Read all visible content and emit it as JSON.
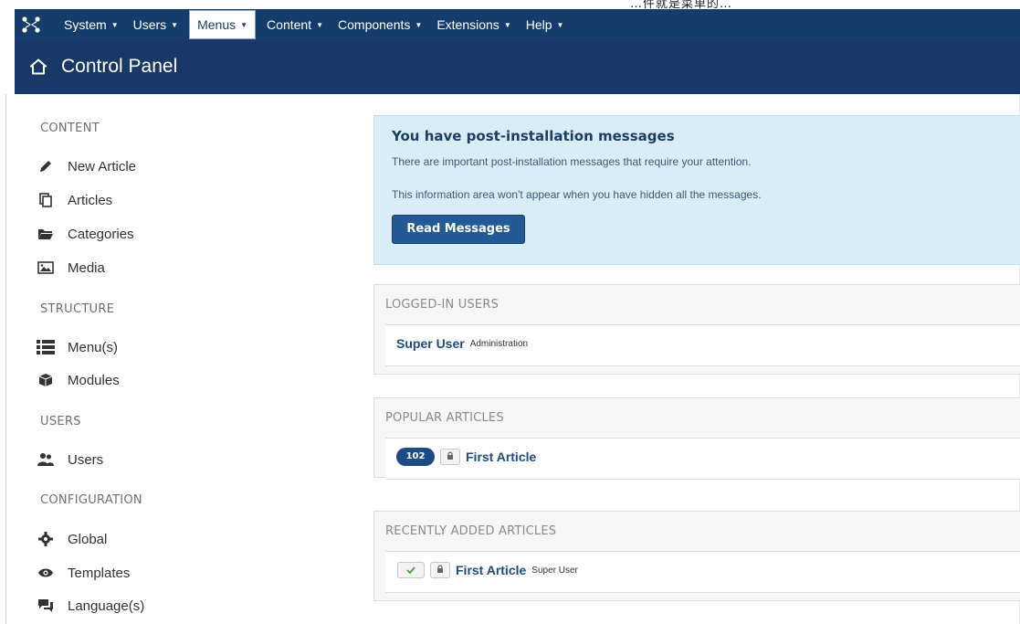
{
  "top_fragment": "…件就是菜单的…",
  "navbar": {
    "items": [
      {
        "label": "System",
        "active": false
      },
      {
        "label": "Users",
        "active": false
      },
      {
        "label": "Menus",
        "active": true
      },
      {
        "label": "Content",
        "active": false
      },
      {
        "label": "Components",
        "active": false
      },
      {
        "label": "Extensions",
        "active": false
      },
      {
        "label": "Help",
        "active": false
      }
    ]
  },
  "header": {
    "title": "Control Panel",
    "icon": "home-icon"
  },
  "sidebar": {
    "content_heading": "CONTENT",
    "content_items": [
      {
        "label": "New Article",
        "icon": "pencil-icon"
      },
      {
        "label": "Articles",
        "icon": "copy-icon"
      },
      {
        "label": "Categories",
        "icon": "folder-icon"
      },
      {
        "label": "Media",
        "icon": "image-icon"
      }
    ],
    "structure_heading": "STRUCTURE",
    "structure_items": [
      {
        "label": "Menu(s)",
        "icon": "list-icon"
      },
      {
        "label": "Modules",
        "icon": "cube-icon"
      }
    ],
    "users_heading": "USERS",
    "users_items": [
      {
        "label": "Users",
        "icon": "users-icon"
      }
    ],
    "config_heading": "CONFIGURATION",
    "config_items": [
      {
        "label": "Global",
        "icon": "gear-icon"
      },
      {
        "label": "Templates",
        "icon": "eye-icon"
      },
      {
        "label": "Language(s)",
        "icon": "comments-icon"
      }
    ]
  },
  "postinstall": {
    "title": "You have post-installation messages",
    "line1": "There are important post-installation messages that require your attention.",
    "line2": "This information area won't appear when you have hidden all the messages.",
    "button": "Read Messages"
  },
  "logged_in": {
    "heading": "LOGGED-IN USERS",
    "user": "Super User",
    "location": "Administration"
  },
  "popular": {
    "heading": "POPULAR ARTICLES",
    "hits": "102",
    "title": "First Article"
  },
  "recent": {
    "heading": "RECENTLY ADDED ARTICLES",
    "title": "First Article",
    "author": "Super User"
  },
  "colors": {
    "navbar": "#153d6c",
    "header": "#1a3867",
    "alert_bg": "#d9edf7",
    "link": "#1e4b86",
    "button": "#235a96"
  }
}
